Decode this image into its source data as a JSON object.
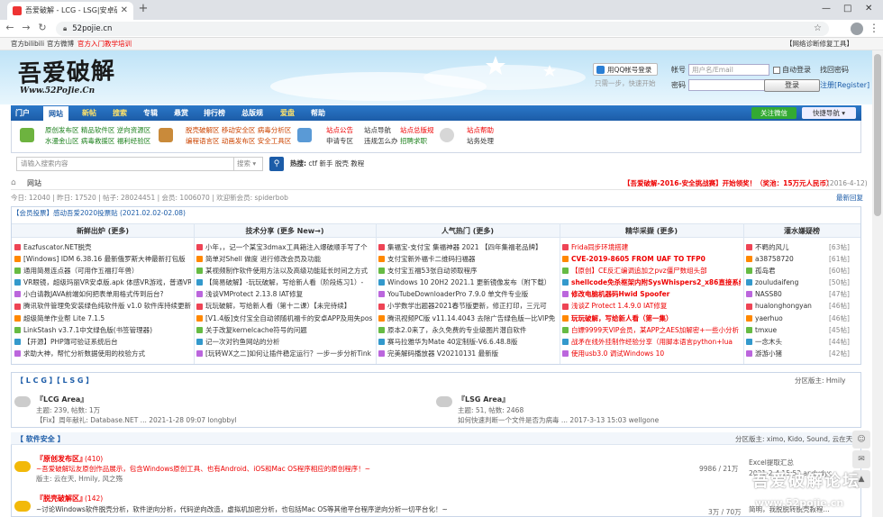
{
  "browser": {
    "tab_title": "吾爱破解 - LCG - LSG|安卓破解|...",
    "url": "52pojie.cn",
    "win_min": "—",
    "win_max": "□",
    "win_close": "✕"
  },
  "toplinks": {
    "bilibili": "官方bilibili",
    "weibo": "官方微博",
    "tutorial": "官方入门教学培训",
    "diag": "【网络诊断修复工具】"
  },
  "header": {
    "logo": "吾爱破解",
    "logo_sub": "Www.52PoJie.Cn",
    "qq_login": "用QQ帐号登录",
    "qq_hint": "只需一步，快速开始",
    "account_label": "帐号",
    "account_placeholder": "用户名/Email",
    "password_label": "密码",
    "auto_login": "自动登录",
    "find_password": "找回密码",
    "login_btn": "登录",
    "register": "注册[Register]"
  },
  "nav": {
    "items": [
      "门户",
      "网站",
      "新帖",
      "搜索",
      "专辑",
      "悬赏",
      "排行榜",
      "总版规",
      "爱盘",
      "帮助"
    ],
    "follow": "关注微信",
    "quick": "快捷导航 ▾"
  },
  "subnav": {
    "col1": [
      [
        "原创发布区",
        "精品软件区",
        "逆向资源区"
      ],
      [
        "水漫金山区",
        "病毒救援区",
        "福利经验区"
      ]
    ],
    "col2": [
      [
        "脱壳破解区",
        "移动安全区",
        "病毒分析区"
      ],
      [
        "编程语言区",
        "动画发布区",
        "安全工具区"
      ]
    ],
    "col3": [
      [
        "站点公告"
      ],
      [
        "申请专区"
      ]
    ],
    "col3b": [
      [
        "站点总版规"
      ],
      [
        "招聘求职"
      ]
    ],
    "col4": [
      [
        "站点导航"
      ],
      [
        "违规怎么办"
      ]
    ],
    "col5": [
      [
        "站点帮助"
      ],
      [
        "站务处理"
      ]
    ]
  },
  "search": {
    "placeholder": "请输入搜索内容",
    "select": "搜索 ▾",
    "hot_label": "热搜:",
    "hot": [
      "ctf",
      "新手",
      "脱壳",
      "教程"
    ]
  },
  "crumb": {
    "home": "⌂",
    "site": "网站",
    "announce": "【吾爱破解-2016-安全挑战赛】开始领奖！（奖池：15万元人民币）",
    "announce_date": "(2016-4-12)",
    "latest": "最新回复"
  },
  "stats": "今日: 12040 | 昨日: 17520 | 帖子: 28024451 | 会员: 1006070 | 欢迎新会员: spiderbob",
  "promo": "【会员投票】感动吾爱2020投票贴 (2021.02.02-02.08)",
  "columns": {
    "heads": [
      "新鲜出炉 (更多)",
      "技术分享 (更多 New→)",
      "人气热门 (更多)",
      "精华采撷 (更多)",
      "灌水嫌疑榜"
    ],
    "c1": [
      "Eazfuscator.NET脱壳",
      "[Windows] IDM 6.38.16 最新俄罗斯大神最新打包版",
      "通用简易连点器（可用作五福打年兽）",
      "VR眼镜，超级玛丽VR安卓版.apk 体感VR游戏，普通VR",
      "小白请教JAVA前端如何把表单用格式传到后台?",
      "腾讯软件管理免安装绿色纯软件版 v1.0 软件库持续更新",
      "超级简单作业帮 Lite 7.1.5",
      "LinkStash v3.7.1中文绿色版(书签管理器)",
      "【开源】PHP簿可验证系统后台",
      "求助大神，帮忙分析数据使用的校验方式"
    ],
    "c2": [
      "小年，，记一个某宝3dmax工具箱注入爆破顺手写了个",
      "简单对Shell 做度 进行修改会员及功能",
      "某视频制作软件使用方法以及高级功能延长时间之方式",
      "【简易破解】-玩玩破解，写给新人看（阶段练习1）-",
      "浅谈VMProtect 2.13.8 IAT修复",
      "玩玩破解，写给新人看（第十二课）【未完待续】",
      "[V1.4版]支付宝全自动领随机福卡的安卓APP及用失pos",
      "关于改复kernelcache符号的问题",
      "记一次对钓鱼网站的分析",
      "[玩转WX之二]如何让插件稳定运行？一步一步分析Tink"
    ],
    "c3": [
      "集福宝-支付宝 集福神器 2021 【四年集福老品牌】",
      "支付宝新外福卡二维码扫福器",
      "支付宝五福53张自动领取程序",
      "Windows 10 20H2 2021.1 更新镜像发布（附下载）",
      "YouTubeDownloaderPro 7.9.0 单文件专业版",
      "小学数学出题器2021春节版更新，修正打印，三元可",
      "腾讯视频PC版 v11.14.4043 去除广告绿色版—比VIP免",
      "原本2.0来了，永久免费的专业级图片潜自软件",
      "赛马拉雅华为Mate 40定制版-V6.6.48.8版",
      "完美解码播放器 V20210131 最新版"
    ],
    "c4": [
      "Frida同步环境搭建",
      "CVE-2019-8605 FROM UAF TO TFP0",
      "【原创】CE反汇编调追加之pvz僵尸数组头部",
      "shellcode免杀框架内附SysWhispers2_x86直接系统调",
      "修改电脑机器码Hwid Spoofer",
      "浅谈Z Protect 1.4.9.0 IAT修复",
      "玩玩破解，写给新人看（第一集）",
      "白嫖9999天VIP会员，某APP之AES加解密+一些小分析",
      "战矛在线外挂制作经验分享（用脚本语言python+lua",
      "使用usb3.0 调试Windows 10"
    ],
    "c5": [
      "不羁的风儿",
      "a38758720",
      "孤岛君",
      "zouludaifeng",
      "NASS80",
      "hualonghongyan",
      "yaerhuo",
      "tmxue",
      "一念木头",
      "游游小猪"
    ],
    "c5n": [
      "[63帖]",
      "[61帖]",
      "[60帖]",
      "[50帖]",
      "[47帖]",
      "[46帖]",
      "[46帖]",
      "[45帖]",
      "[44帖]",
      "[42帖]"
    ]
  },
  "lcg": {
    "title": "【 L C G 】【 L S G 】",
    "moderator": "分区版主: Hmily",
    "lcg_name": "『LCG Area』",
    "lcg_stats": "主题: 239, 帖数: 1万",
    "lcg_last": "【Fix】周年献礼: Database.NET ... 2021-1-28 09:07 longbbyl",
    "lsg_name": "『LSG Area』",
    "lsg_stats": "主题: 51, 帖数: 2468",
    "lsg_last": "如何快速判断一个文件是否为病毒 ... 2017-3-13 15:03 wellgone"
  },
  "soft": {
    "title": "【 软件安全 】",
    "moderators": "分区版主: ximo, Kido, Sound, 云在天",
    "f1_name": "『原创发布区』",
    "f1_count": "(410)",
    "f1_desc": "~吾爱破解坛友原创作品展示，包含Windows原创工具、也有Android、iOS和Mac OS程序相应的原创程序！~",
    "f1_mods": "版主: 云在天, Hmily, 风之殇",
    "f1_stats": "9986 / 21万",
    "f1_last": "Excel提取汇总",
    "f1_last_info": "2021-2-4 15:52 andydyc",
    "f2_name": "『脱壳破解区』",
    "f2_count": "(142)",
    "f2_desc": "~讨论Windows软件脱壳分析，软件逆向分析，代码逆向改造，虚拟机加密分析，也包括Mac OS等其他平台程序逆向分析一切平台化！~",
    "f2_stats": "3万 / 70万",
    "f2_last": "简明，我脱脱转脱壳教程..."
  },
  "watermark": "吾爱破解论坛",
  "watermark_url": "www.52pojie.cn",
  "colors": {
    "nav": "#1c5ca8",
    "red": "#e00",
    "accent": "#2b78c8"
  }
}
